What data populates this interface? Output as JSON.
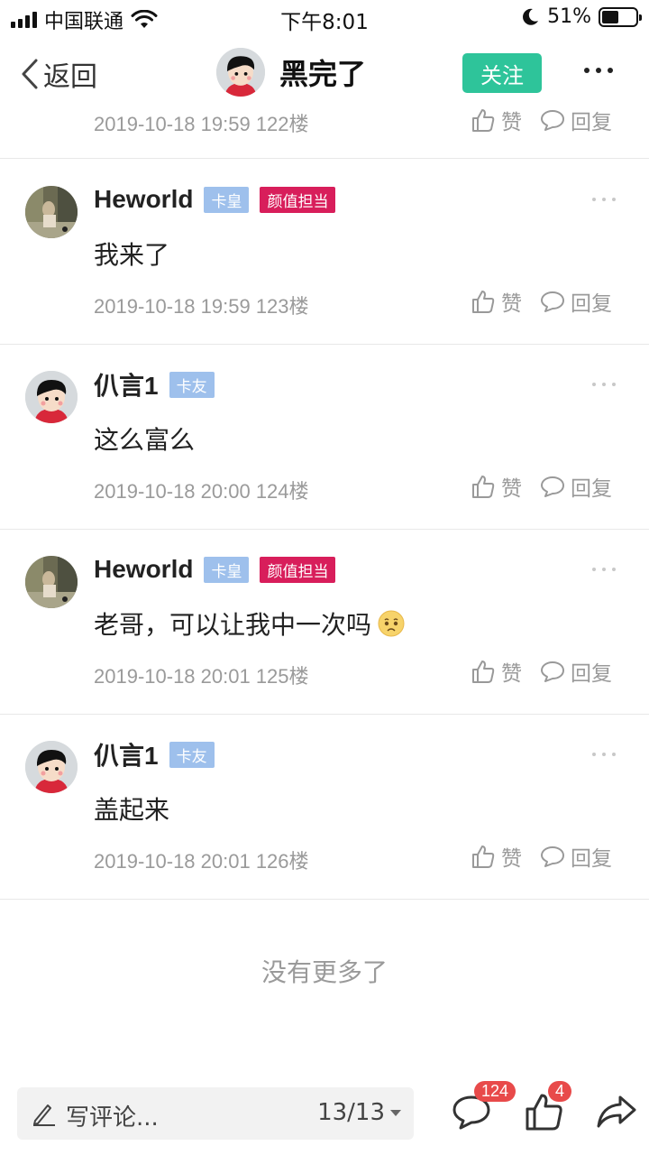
{
  "status_bar": {
    "carrier": "中国联通",
    "time": "下午8:01",
    "battery": "51%",
    "battery_level": 0.51
  },
  "nav": {
    "back_label": "返回",
    "title": "黑完了",
    "follow_label": "关注"
  },
  "actions": {
    "like_label": "赞",
    "reply_label": "回复"
  },
  "partial_comment": {
    "meta": "2019-10-18 19:59  122楼"
  },
  "comments": [
    {
      "name": "Heworld",
      "avatar": "photo-avatar",
      "badges": [
        "卡皇",
        "颜值担当"
      ],
      "text": "我来了",
      "meta": "2019-10-18 19:59  123楼"
    },
    {
      "name": "仈言1",
      "avatar": "cartoon-girl-avatar",
      "badges": [
        "卡友"
      ],
      "text": "这么富么",
      "meta": "2019-10-18 20:00  124楼"
    },
    {
      "name": "Heworld",
      "avatar": "photo-avatar",
      "badges": [
        "卡皇",
        "颜值担当"
      ],
      "text": "老哥，可以让我中一次吗",
      "emoji": "sad-face-emoji",
      "meta": "2019-10-18 20:01  125楼"
    },
    {
      "name": "仈言1",
      "avatar": "cartoon-girl-avatar",
      "badges": [
        "卡友"
      ],
      "text": "盖起来",
      "meta": "2019-10-18 20:01  126楼"
    }
  ],
  "footer": {
    "no_more": "没有更多了"
  },
  "bottom_bar": {
    "comment_placeholder": "写评论...",
    "page_indicator": "13/13",
    "comment_count": "124",
    "like_count": "4"
  },
  "colors": {
    "accent_green": "#2ec49a",
    "badge_blue": "#9ec0ec",
    "badge_red": "#d81e5b",
    "count_red": "#e84a4a"
  }
}
